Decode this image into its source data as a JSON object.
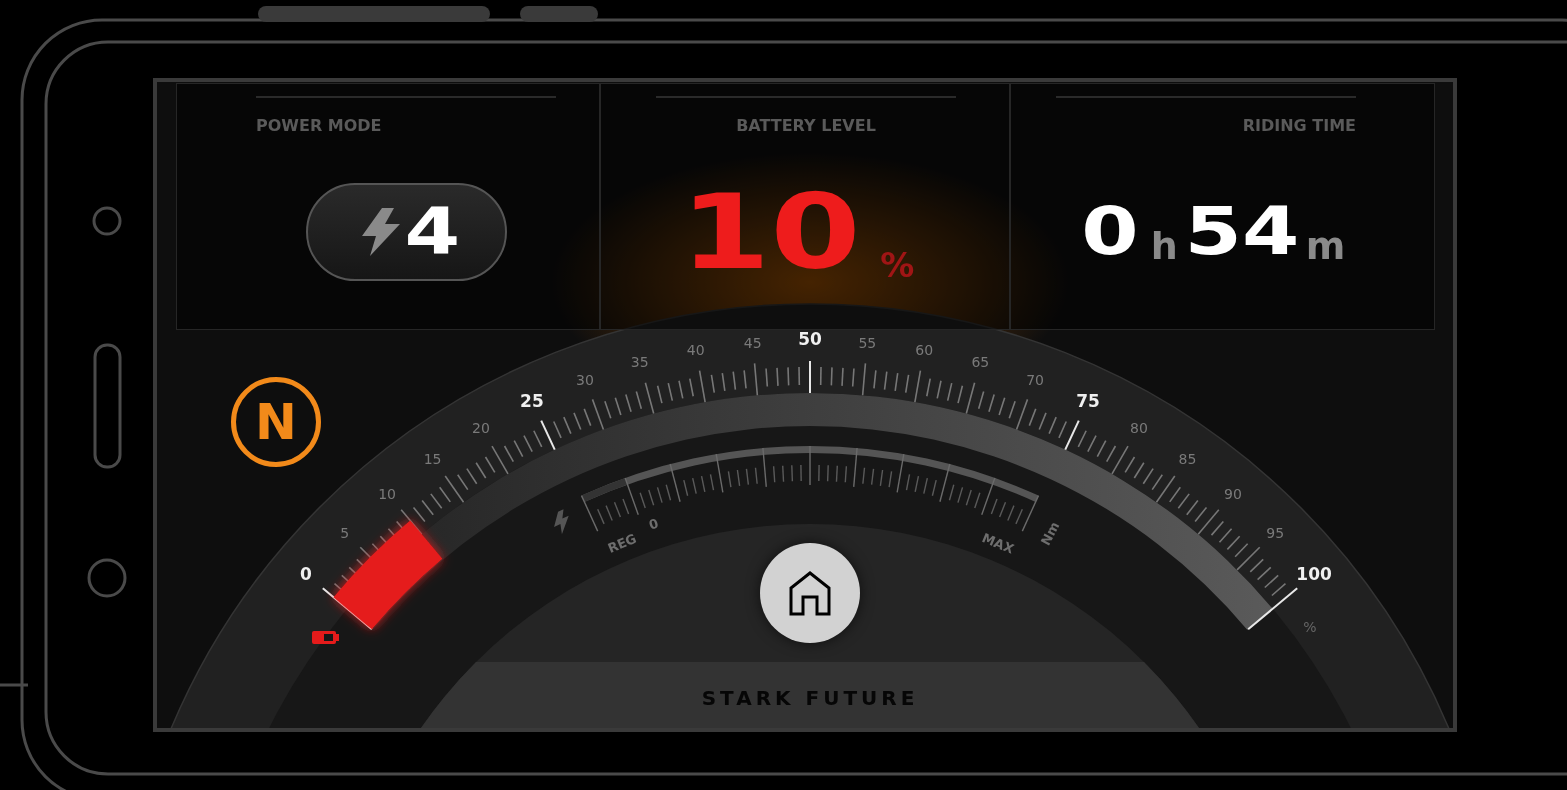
{
  "panels": [
    {
      "kind": "power_mode",
      "label": "POWER MODE",
      "value": "4"
    },
    {
      "kind": "battery",
      "label": "BATTERY LEVEL",
      "value": "10",
      "unit": "%"
    },
    {
      "kind": "time",
      "label": "RIDING TIME",
      "hours": "0",
      "hours_unit": "h",
      "minutes": "54",
      "minutes_unit": "m"
    }
  ],
  "gear": "N",
  "gauge": {
    "level": 0.1,
    "unit": "%",
    "scale_labels": [
      {
        "text": "0",
        "bold": true
      },
      {
        "text": "5",
        "bold": false
      },
      {
        "text": "10",
        "bold": false
      },
      {
        "text": "15",
        "bold": false
      },
      {
        "text": "20",
        "bold": false
      },
      {
        "text": "25",
        "bold": true
      },
      {
        "text": "30",
        "bold": false
      },
      {
        "text": "35",
        "bold": false
      },
      {
        "text": "40",
        "bold": false
      },
      {
        "text": "45",
        "bold": false
      },
      {
        "text": "50",
        "bold": true
      },
      {
        "text": "55",
        "bold": false
      },
      {
        "text": "60",
        "bold": false
      },
      {
        "text": "65",
        "bold": false
      },
      {
        "text": "70",
        "bold": false
      },
      {
        "text": "75",
        "bold": true
      },
      {
        "text": "80",
        "bold": false
      },
      {
        "text": "85",
        "bold": false
      },
      {
        "text": "90",
        "bold": false
      },
      {
        "text": "95",
        "bold": false
      },
      {
        "text": "100",
        "bold": true
      }
    ],
    "torque": {
      "start_label": "REG",
      "zero_label": "0",
      "end_label": "MAX",
      "unit": "Nm"
    }
  },
  "brand": "STARK FUTURE"
}
